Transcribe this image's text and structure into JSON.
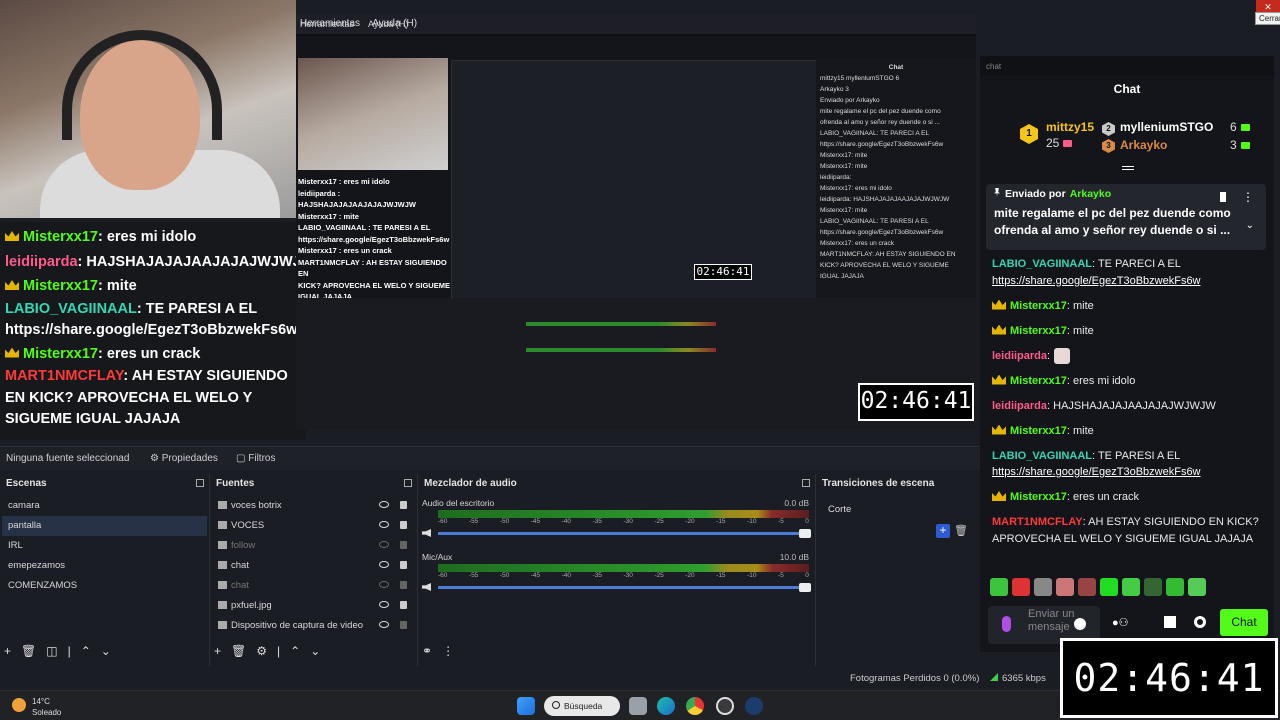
{
  "window": {
    "close_tooltip": "Cerrar",
    "close_symbol": "✕"
  },
  "menu": {
    "tools": "Herramientas",
    "help": "Ayuda (H)"
  },
  "overlay_chat": [
    {
      "user": "Misterxx17",
      "text": ": eres mi idolo"
    },
    {
      "user": "leidiiparda",
      "text": ": HAJSHAJAJAJAAJAJAJWJWJW"
    },
    {
      "user": "Misterxx17",
      "text": ": mite"
    },
    {
      "user": "LABIO_VAGIINAAL",
      "text": ": TE PARESI A EL https://share.google/EgezT3oBbzwekFs6w"
    },
    {
      "user": "Misterxx17",
      "text": ": eres un crack"
    },
    {
      "user": "MART1NMCFLAY",
      "text": ": AH ESTAY SIGUIENDO EN KICK? APROVECHA EL WELO Y SIGUEME IGUAL JAJAJA"
    }
  ],
  "capture": {
    "menu_tools": "Herramientas",
    "menu_help": "Ayuda (H)",
    "mini_timer": "02:46:41",
    "mini_chat": [
      "Misterxx17 : eres mi idolo",
      "leidiiparda : HAJSHAJAJAJAAJAJAJWJWJW",
      "Misterxx17 : mite",
      "LABIO_VAGIINAAL : TE PARESI A EL",
      "https://share.google/EgezT3oBbzwekFs6w",
      "Misterxx17 : eres un crack",
      "MART1NMCFLAY : AH ESTAY SIGUIENDO EN",
      "KICK? APROVECHA EL WELO Y SIGUEME",
      "IGUAL JAJAJA"
    ],
    "mini_rchat_title": "Chat",
    "mini_rchat": [
      "mittzy15  myllenlumSTGO 6",
      "Arkayko 3",
      "Enviado por Arkayko",
      "mite regalame el pc del pez duende como",
      "ofrenda al amo y señor rey duende o si ...",
      "LABIO_VAGIINAAL: TE PARECI A EL",
      "https://share.google/EgezT3oBbzwekFs6w",
      "Misterxx17: mite",
      "Misterxx17: mite",
      "leidiiparda:",
      "Misterxx17: eres mi idolo",
      "leidiiparda: HAJSHAJAJAJAAJAJAJWJWJW",
      "Misterxx17: mite",
      "LABIO_VAGIINAAL: TE PARESI A EL",
      "https://share.google/EgezT3oBbzwekFs6w",
      "Misterxx17: eres un crack",
      "MART1NMCFLAY: AH ESTAY SIGUIENDO EN",
      "KICK? APROVECHA EL WELO Y SIGUEME",
      "IGUAL JAJAJA"
    ]
  },
  "mid_timer": "02:46:41",
  "obs": {
    "no_source": "Ninguna fuente seleccionad",
    "properties": "Propiedades",
    "filters": "Filtros",
    "scenes_title": "Escenas",
    "scenes": [
      {
        "label": "camara",
        "selected": false
      },
      {
        "label": "pantalla",
        "selected": true
      },
      {
        "label": "IRL",
        "selected": false
      },
      {
        "label": "emepezamos",
        "selected": false
      },
      {
        "label": "COMENZAMOS",
        "selected": false
      }
    ],
    "sources_title": "Fuentes",
    "sources": [
      {
        "label": "voces botrix",
        "visible": true,
        "locked": true
      },
      {
        "label": "VOCES",
        "visible": true,
        "locked": true
      },
      {
        "label": "follow",
        "visible": false,
        "locked": false
      },
      {
        "label": "chat",
        "visible": true,
        "locked": true
      },
      {
        "label": "chat",
        "visible": false,
        "locked": false
      },
      {
        "label": "pxfuel.jpg",
        "visible": true,
        "locked": true
      },
      {
        "label": "Dispositivo de captura de video",
        "visible": true,
        "locked": false
      }
    ],
    "mixer_title": "Mezclador de audio",
    "tracks": [
      {
        "name": "Audio del escritorio",
        "db": "0.0 dB",
        "level": 1.0
      },
      {
        "name": "Mic/Aux",
        "db": "10.0 dB",
        "level": 1.0
      }
    ],
    "meter_ticks": [
      "-60",
      "-55",
      "-50",
      "-45",
      "-40",
      "-35",
      "-30",
      "-25",
      "-20",
      "-15",
      "-10",
      "-5",
      "0"
    ],
    "transitions_title": "Transiciones de escena",
    "transition_value": "Corte",
    "dropped_frames": "Fotogramas Perdidos 0 (0.0%)",
    "bitrate": "6365 kbps"
  },
  "taskbar": {
    "temp": "14°C",
    "weather": "Soleado",
    "search": "Búsqueda"
  },
  "kick": {
    "search_placeholder": "chat",
    "title": "Chat",
    "gifters": [
      {
        "rank": "1",
        "name": "mittzy15",
        "count": "25"
      },
      {
        "rank": "2",
        "name": "mylleniumSTGO",
        "count": "6"
      },
      {
        "rank": "3",
        "name": "Arkayko",
        "count": "3"
      }
    ],
    "pinned": {
      "label": "Enviado por",
      "by": "Arkayko",
      "message": "mite regalame el pc del pez duende como ofrenda al amo y señor rey duende o si ..."
    },
    "messages": [
      {
        "user": "LABIO_VAGIINAAL",
        "color": "#36d6b5",
        "text": ": TE PARECI A EL ",
        "link": "https://share.google/EgezT3oBbzwekFs6w",
        "crown": false
      },
      {
        "user": "Misterxx17",
        "color": "#53fc18",
        "text": ": mite",
        "link": "",
        "crown": true
      },
      {
        "user": "Misterxx17",
        "color": "#53fc18",
        "text": ": mite",
        "link": "",
        "crown": true
      },
      {
        "user": "leidiiparda",
        "color": "#ff5b8a",
        "text": ":",
        "link": "",
        "crown": false,
        "emote": true
      },
      {
        "user": "Misterxx17",
        "color": "#53fc18",
        "text": ": eres mi idolo",
        "link": "",
        "crown": true
      },
      {
        "user": "leidiiparda",
        "color": "#ff5b8a",
        "text": ": HAJSHAJAJAJAAJAJAJWJWJW",
        "link": "",
        "crown": false
      },
      {
        "user": "Misterxx17",
        "color": "#53fc18",
        "text": ": mite",
        "link": "",
        "crown": true
      },
      {
        "user": "LABIO_VAGIINAAL",
        "color": "#36d6b5",
        "text": ": TE PARESI A EL ",
        "link": "https://share.google/EgezT3oBbzwekFs6w",
        "crown": false
      },
      {
        "user": "Misterxx17",
        "color": "#53fc18",
        "text": ": eres un crack",
        "link": "",
        "crown": true
      },
      {
        "user": "MART1NMCFLAY",
        "color": "#ff3a3a",
        "text": ": AH ESTAY SIGUIENDO EN KICK? APROVECHA EL WELO Y SIGUEME IGUAL JAJAJA",
        "link": "",
        "crown": false
      }
    ],
    "emotes": [
      "#3cc43c",
      "#d33",
      "#888",
      "#c77",
      "#944",
      "#2d2",
      "#4c4",
      "#363",
      "#3b3",
      "#5c5"
    ],
    "input_placeholder": "Enviar un mensaje",
    "chat_button": "Chat",
    "accent": "#53fc18"
  },
  "big_timer": "02:46:41"
}
